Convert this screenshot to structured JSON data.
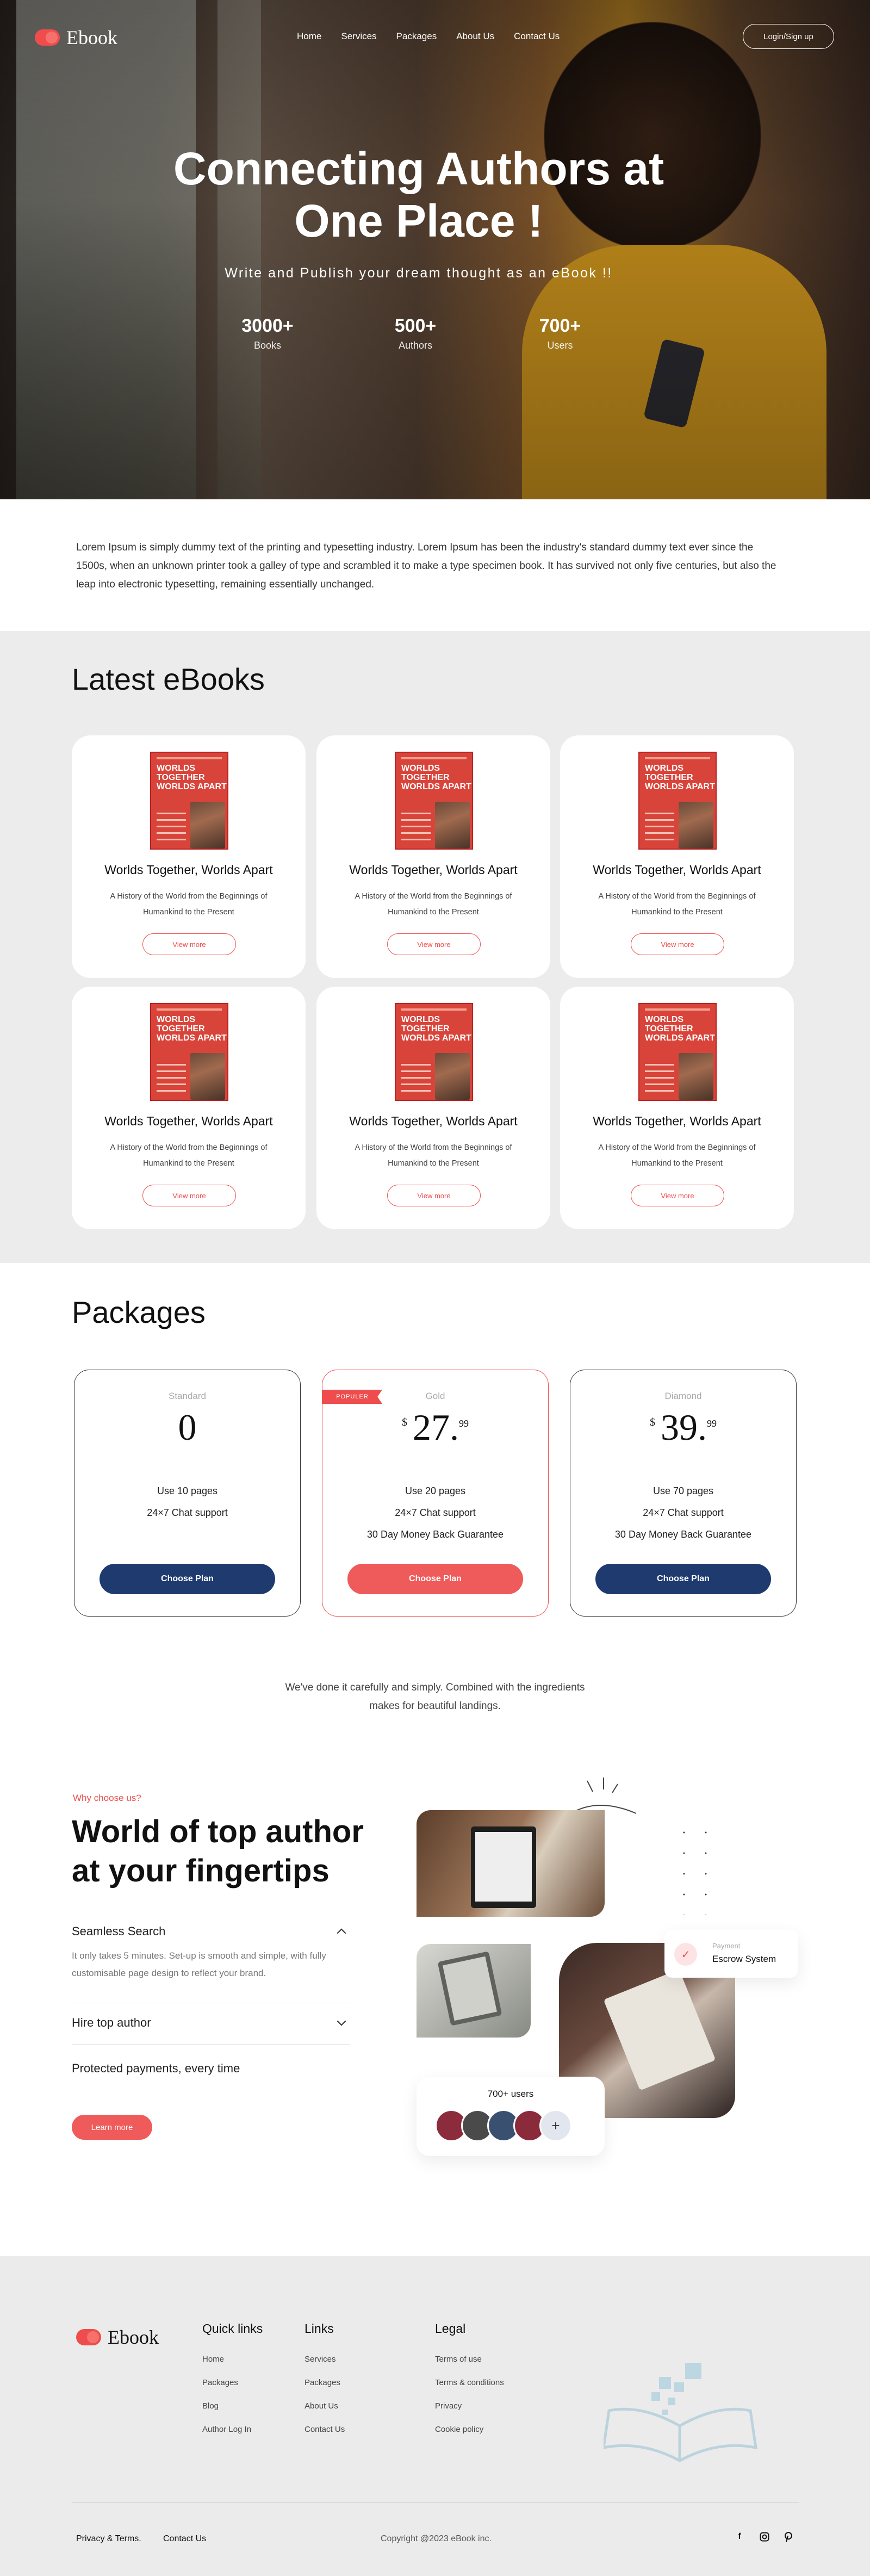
{
  "brand": {
    "name": "Ebook",
    "accent": "#ef4d4d",
    "navy": "#1e3a6e"
  },
  "nav": {
    "items": [
      "Home",
      "Services",
      "Packages",
      "About Us",
      "Contact Us"
    ],
    "login": "Login/Sign up"
  },
  "hero": {
    "title_line1": "Connecting Authors at",
    "title_line2": "One Place !",
    "subtitle": "Write and Publish your dream thought as an eBook !!",
    "stats": [
      {
        "value": "3000+",
        "label": "Books"
      },
      {
        "value": "500+",
        "label": "Authors"
      },
      {
        "value": "700+",
        "label": "Users"
      }
    ]
  },
  "intro": "Lorem Ipsum is simply dummy text of the printing and typesetting industry. Lorem Ipsum has been the industry's standard dummy text ever since the 1500s, when an unknown printer took a galley of type and scrambled it to make a type specimen book. It has survived not only five centuries, but also the leap into electronic typesetting, remaining essentially unchanged.",
  "latest": {
    "heading": "Latest eBooks",
    "cover_text": "WORLDS TOGETHER WORLDS APART",
    "books": [
      {
        "title": "Worlds Together, Worlds Apart",
        "desc": "A History of the World from the Beginnings of Humankind to the Present",
        "button": "View more"
      },
      {
        "title": "Worlds Together, Worlds Apart",
        "desc": "A History of the World from the Beginnings of Humankind to the Present",
        "button": "View more"
      },
      {
        "title": "Worlds Together, Worlds Apart",
        "desc": "A History of the World from the Beginnings of Humankind to the Present",
        "button": "View more"
      },
      {
        "title": "Worlds Together, Worlds Apart",
        "desc": "A History of the World from the Beginnings of Humankind to the Present",
        "button": "View more"
      },
      {
        "title": "Worlds Together, Worlds Apart",
        "desc": "A History of the World from the Beginnings of Humankind to the Present",
        "button": "View more"
      },
      {
        "title": "Worlds Together, Worlds Apart",
        "desc": "A History of the World from the Beginnings of Humankind to the Present",
        "button": "View more"
      }
    ]
  },
  "packages": {
    "heading": "Packages",
    "popular": "POPULER",
    "plans": [
      {
        "name": "Standard",
        "currency": "",
        "price": "0",
        "cents": "",
        "features": [
          "Use 10 pages",
          "24×7 Chat support"
        ],
        "button": "Choose Plan"
      },
      {
        "name": "Gold",
        "currency": "$",
        "price": "27.",
        "cents": "99",
        "features": [
          "Use 20 pages",
          "24×7 Chat support",
          "30 Day Money Back Guarantee"
        ],
        "button": "Choose Plan"
      },
      {
        "name": "Diamond",
        "currency": "$",
        "price": "39.",
        "cents": "99",
        "features": [
          "Use 70 pages",
          "24×7 Chat support",
          "30 Day Money Back Guarantee"
        ],
        "button": "Choose Plan"
      }
    ]
  },
  "tagline": "We've done it carefully and simply. Combined with the ingredients makes for beautiful landings.",
  "why": {
    "eyebrow": "Why choose us?",
    "heading": "World of top author at your fingertips",
    "items": [
      {
        "title": "Seamless Search",
        "body": "It only takes 5 minutes. Set-up is smooth and simple, with fully customisable page design to reflect your brand."
      },
      {
        "title": "Hire top author"
      },
      {
        "title": "Protected payments, every time"
      }
    ],
    "button": "Learn more",
    "users_label": "700+ users",
    "payment_label": "Payment",
    "payment_title": "Escrow System"
  },
  "footer": {
    "brand": "Ebook",
    "cols": [
      {
        "title": "Quick links",
        "links": [
          "Home",
          "Packages",
          "Blog",
          "Author Log In"
        ]
      },
      {
        "title": "Links",
        "links": [
          "Services",
          "Packages",
          "About Us",
          "Contact Us"
        ]
      },
      {
        "title": "Legal",
        "links": [
          "Terms of use",
          "Terms & conditions",
          "Privacy",
          "Cookie policy"
        ]
      }
    ],
    "privacy": "Privacy & Terms.",
    "contact": "Contact Us",
    "copyright": "Copyright @2023 eBook inc."
  }
}
